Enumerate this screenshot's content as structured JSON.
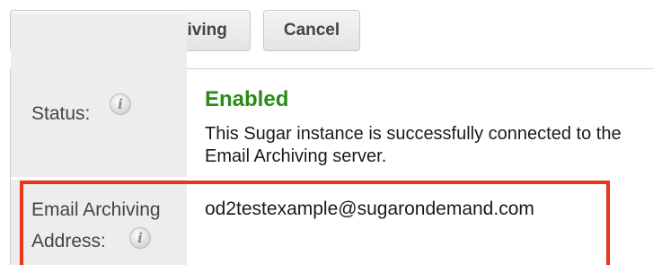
{
  "buttons": {
    "disable_label": "Disable Email Archiving",
    "cancel_label": "Cancel"
  },
  "status": {
    "label": "Status:",
    "value": "Enabled",
    "description": "This Sugar instance is successfully connected to the Email Archiving server."
  },
  "archive_address": {
    "label_line1": "Email Archiving",
    "label_line2": "Address:",
    "value": "od2testexample@sugarondemand.com"
  },
  "icons": {
    "info": "i"
  },
  "colors": {
    "enabled_green": "#2b8a14",
    "highlight_red": "#e8361a",
    "label_bg": "#ededed"
  }
}
